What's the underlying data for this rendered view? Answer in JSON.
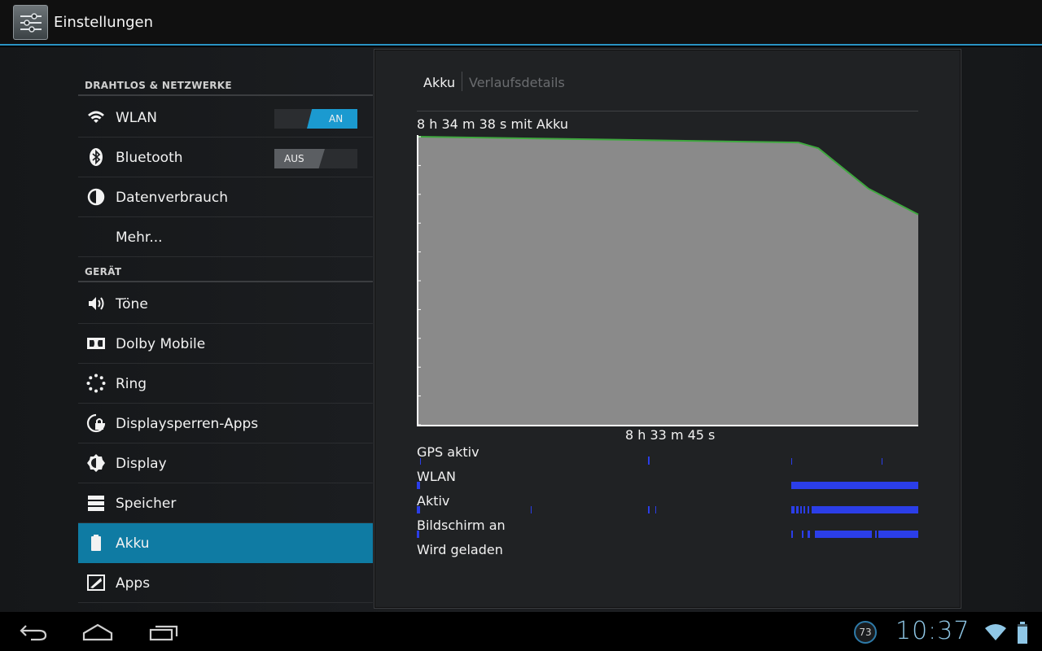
{
  "app": {
    "title": "Einstellungen"
  },
  "sidebar": {
    "sections": [
      {
        "header": "DRAHTLOS & NETZWERKE"
      },
      {
        "header": "GERÄT"
      }
    ],
    "items": [
      {
        "label": "WLAN",
        "icon": "wifi-icon",
        "toggle": "AN"
      },
      {
        "label": "Bluetooth",
        "icon": "bluetooth-icon",
        "toggle": "AUS"
      },
      {
        "label": "Datenverbrauch",
        "icon": "data-usage-icon"
      },
      {
        "label": "Mehr..."
      },
      {
        "label": "Töne",
        "icon": "speaker-icon"
      },
      {
        "label": "Dolby Mobile",
        "icon": "dolby-icon"
      },
      {
        "label": "Ring",
        "icon": "ring-icon"
      },
      {
        "label": "Displaysperren-Apps",
        "icon": "lock-icon"
      },
      {
        "label": "Display",
        "icon": "brightness-icon"
      },
      {
        "label": "Speicher",
        "icon": "storage-icon"
      },
      {
        "label": "Akku",
        "icon": "battery-icon",
        "selected": true
      },
      {
        "label": "Apps",
        "icon": "apps-icon"
      }
    ]
  },
  "detail": {
    "tabs": [
      "Akku",
      "Verlaufsdetails"
    ],
    "battery_time": "8 h 34 m 38 s mit Akku",
    "graph_x_label": "8 h 33 m 45 s",
    "lanes": [
      "GPS aktiv",
      "WLAN",
      "Aktiv",
      "Bildschirm an",
      "Wird geladen"
    ]
  },
  "chart_data": {
    "type": "area",
    "series": [
      {
        "name": "",
        "x": [
          0,
          0.76,
          0.8,
          0.9,
          1.0
        ],
        "y": [
          100,
          98,
          96,
          82,
          73
        ]
      }
    ],
    "ylim": [
      0,
      100
    ],
    "colors": {
      "fill": "#8a8a8a",
      "line": "#3fa83f",
      "axis": "#ffffff"
    }
  },
  "statusbar": {
    "clock": "10:37",
    "notification_count": "73"
  },
  "colors": {
    "accent": "#2a93c4",
    "selected": "#0f7ba3",
    "lane_bar": "#2b3ee8"
  }
}
